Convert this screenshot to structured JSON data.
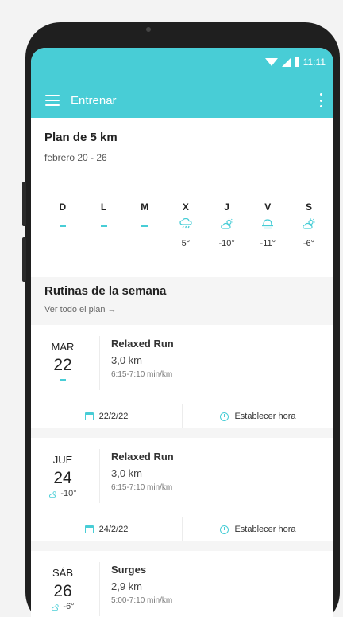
{
  "statusbar": {
    "time": "11:11"
  },
  "appbar": {
    "title": "Entrenar"
  },
  "plan": {
    "title": "Plan de 5 km",
    "range": "febrero 20 - 26",
    "days": [
      {
        "letter": "D",
        "temp": "",
        "weather": "none"
      },
      {
        "letter": "L",
        "temp": "",
        "weather": "none"
      },
      {
        "letter": "M",
        "temp": "",
        "weather": "none"
      },
      {
        "letter": "X",
        "temp": "5°",
        "weather": "rain-icon"
      },
      {
        "letter": "J",
        "temp": "-10°",
        "weather": "partly-cloudy-icon"
      },
      {
        "letter": "V",
        "temp": "-11°",
        "weather": "fog-icon"
      },
      {
        "letter": "S",
        "temp": "-6°",
        "weather": "partly-cloudy-icon"
      }
    ]
  },
  "routines": {
    "title": "Rutinas de la semana",
    "link": "Ver todo el plan →",
    "items": [
      {
        "day": "MAR",
        "num": "22",
        "temp": "",
        "name": "Relaxed Run",
        "distance": "3,0 km",
        "pace": "6:15-7:10 min/km",
        "date": "22/2/22",
        "action": "Establecer hora"
      },
      {
        "day": "JUE",
        "num": "24",
        "temp": "-10°",
        "name": "Relaxed Run",
        "distance": "3,0 km",
        "pace": "6:15-7:10 min/km",
        "date": "24/2/22",
        "action": "Establecer hora"
      },
      {
        "day": "SÁB",
        "num": "26",
        "temp": "-6°",
        "name": "Surges",
        "distance": "2,9 km",
        "pace": "5:00-7:10 min/km"
      }
    ]
  },
  "colors": {
    "accent": "#48cdd6",
    "phone": "#1f1f1f"
  }
}
